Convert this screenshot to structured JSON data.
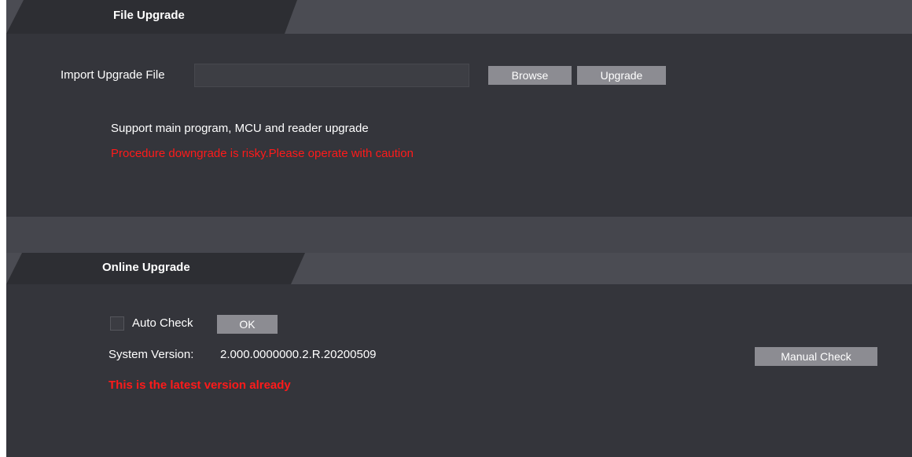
{
  "file_upgrade": {
    "title": "File Upgrade",
    "import_label": "Import Upgrade File",
    "file_value": "",
    "browse_label": "Browse",
    "upgrade_label": "Upgrade",
    "support_text": "Support main program, MCU and reader upgrade",
    "warning_text": "Procedure downgrade is risky.Please operate with caution"
  },
  "online_upgrade": {
    "title": "Online Upgrade",
    "auto_check_label": "Auto Check",
    "auto_check_checked": false,
    "ok_label": "OK",
    "system_version_label": "System Version:",
    "system_version_value": "2.000.0000000.2.R.20200509",
    "manual_check_label": "Manual Check",
    "status_text": "This is the latest version already"
  },
  "colors": {
    "panel_bg": "#34353b",
    "header_bg": "#4b4c53",
    "tab_bg": "#2d2e33",
    "button_bg": "#8c8c92",
    "warning": "#ff1a1a"
  }
}
